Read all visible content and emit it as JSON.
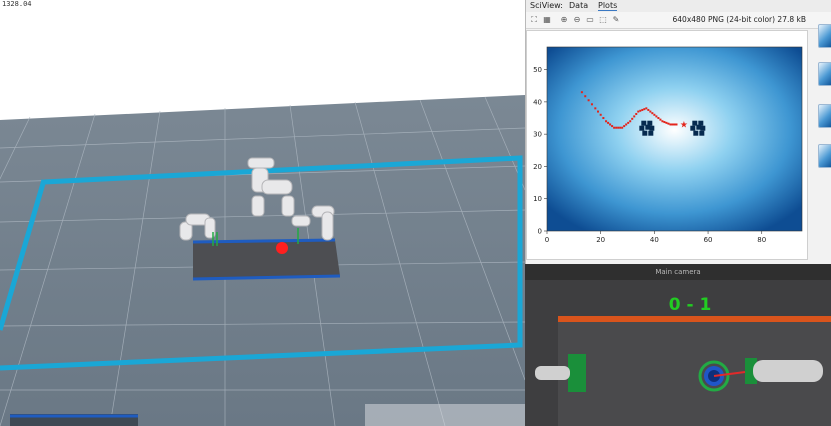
{
  "viewport": {
    "coords_text": "1328.04"
  },
  "sciview": {
    "tabs": [
      "SciView:",
      "Data",
      "Plots"
    ],
    "image_info": "640x480 PNG (24-bit color) 27.8 kB",
    "toolbar_icons": [
      "fit-icon",
      "grid-icon",
      "zoom-in-icon",
      "zoom-out-icon",
      "actual-size-icon",
      "frame-icon",
      "color-picker-icon"
    ]
  },
  "chart_data": {
    "type": "heatmap",
    "xlim": [
      0,
      95
    ],
    "ylim": [
      0,
      57
    ],
    "xticks": [
      "0",
      "20",
      "40",
      "60",
      "80"
    ],
    "yticks": [
      "0",
      "10",
      "20",
      "30",
      "40",
      "50"
    ],
    "path": [
      [
        13,
        43
      ],
      [
        18,
        38
      ],
      [
        22,
        34
      ],
      [
        25,
        32
      ],
      [
        28,
        32
      ],
      [
        31,
        34
      ],
      [
        34,
        37
      ],
      [
        37,
        38
      ],
      [
        40,
        36
      ],
      [
        43,
        34
      ],
      [
        46,
        33
      ],
      [
        49,
        33
      ]
    ],
    "goal_marker": [
      51,
      33
    ],
    "obstacles": [
      [
        37,
        32
      ],
      [
        56,
        32
      ]
    ]
  },
  "camera": {
    "title": "Main camera",
    "score": "0 - 1"
  }
}
